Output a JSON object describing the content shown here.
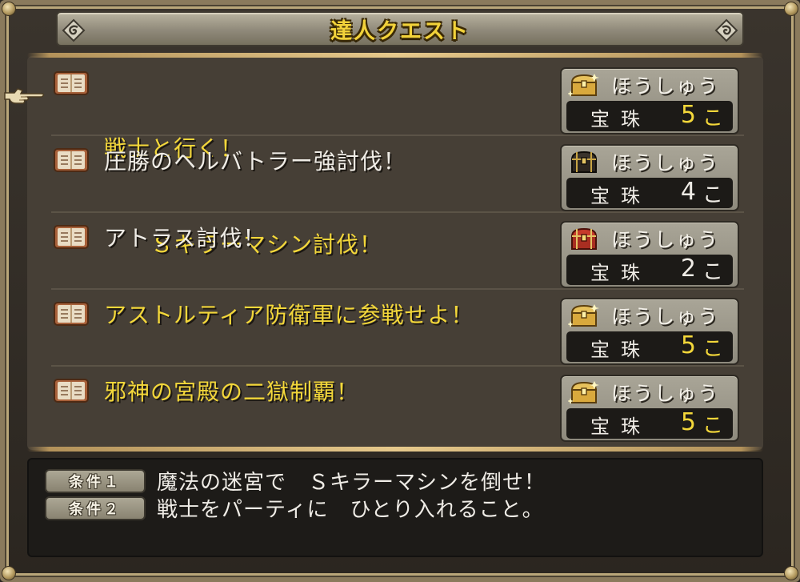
{
  "title": "達人クエスト",
  "quests": [
    {
      "title_line1": "戦士と行く！",
      "title_line2": "　　Ｓキラーマシン討伐！",
      "status": "gold",
      "chest": "gold",
      "reward_label": "ほうしゅう",
      "reward_item": "宝珠",
      "reward_count": "5",
      "reward_unit": "こ"
    },
    {
      "title_line1": "圧勝のヘルバトラー強討伐！",
      "title_line2": "",
      "status": "white",
      "chest": "black",
      "reward_label": "ほうしゅう",
      "reward_item": "宝珠",
      "reward_count": "4",
      "reward_unit": "こ"
    },
    {
      "title_line1": "アトラス討伐！",
      "title_line2": "",
      "status": "white",
      "chest": "red",
      "reward_label": "ほうしゅう",
      "reward_item": "宝珠",
      "reward_count": "2",
      "reward_unit": "こ"
    },
    {
      "title_line1": "アストルティア防衛軍に参戦せよ！",
      "title_line2": "",
      "status": "gold",
      "chest": "gold",
      "reward_label": "ほうしゅう",
      "reward_item": "宝珠",
      "reward_count": "5",
      "reward_unit": "こ"
    },
    {
      "title_line1": "邪神の宮殿の二獄制覇！",
      "title_line2": "",
      "status": "gold",
      "chest": "gold",
      "reward_label": "ほうしゅう",
      "reward_item": "宝珠",
      "reward_count": "5",
      "reward_unit": "こ"
    }
  ],
  "conditions": [
    {
      "label": "条件１",
      "text": "魔法の迷宮で　Ｓキラーマシンを倒せ！"
    },
    {
      "label": "条件２",
      "text": "戦士をパーティに　ひとり入れること。"
    }
  ],
  "colors": {
    "gold_text": "#f3d73a",
    "white_text": "#efece6",
    "panel": "#463f36",
    "reward_box": "#a9a597"
  },
  "icons": {
    "quest": "quest-book-icon",
    "chest_gold": "gold-chest-icon",
    "chest_black": "black-chest-icon",
    "chest_red": "red-chest-icon",
    "cursor": "pointing-hand-cursor-icon"
  }
}
